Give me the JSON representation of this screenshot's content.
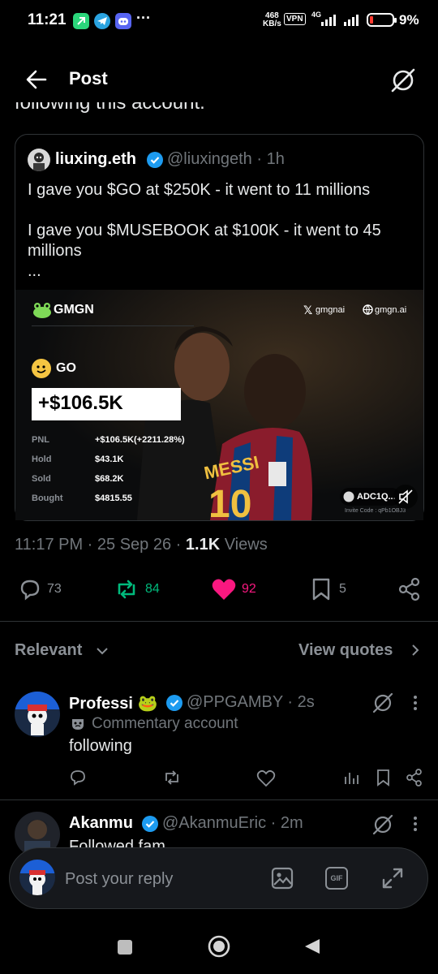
{
  "status_bar": {
    "time": "11:21",
    "more": "···",
    "net_speed_value": "468",
    "net_speed_unit": "KB/s",
    "vpn": "VPN",
    "network": "4G",
    "battery": "9%"
  },
  "header": {
    "title": "Post",
    "back_icon": "arrow-left-icon",
    "grok_icon": "grok-icon"
  },
  "truncated_text": "following this account.",
  "quote": {
    "author_name": "liuxing.eth",
    "author_handle": "@liuxingeth · 1h",
    "line1": "I gave you $GO at $250K - it went to 11 millions",
    "line2a": "I gave you $MUSEBOOK at $100K - it went to 45",
    "line2b": "millions",
    "ellipsis": "...",
    "media": {
      "brand": "GMGN",
      "x_handle": "gmgnai",
      "site": "gmgn.ai",
      "token": "GO",
      "headline_pnl": "+$106.5K",
      "rows": [
        {
          "label": "PNL",
          "value": "+$106.5K(+2211.28%)"
        },
        {
          "label": "Hold",
          "value": "$43.1K"
        },
        {
          "label": "Sold",
          "value": "$68.2K"
        },
        {
          "label": "Bought",
          "value": "$4815.55"
        }
      ],
      "invite_badge": "ADC1Q...",
      "invite_code": "Invite Code : qPb1OBJ3"
    }
  },
  "meta": {
    "time": "11:17 PM",
    "date": "25 Sep 26",
    "views_count": "1.1K",
    "views_label": "Views"
  },
  "actions": {
    "replies": "73",
    "reposts": "84",
    "likes": "92",
    "bookmarks": "5",
    "accent_repost": "#00ba7c",
    "accent_like": "#f91880"
  },
  "filter": {
    "relevant": "Relevant",
    "view_quotes": "View quotes"
  },
  "replies": [
    {
      "name": "Professi 🐸",
      "handle": "@PPGAMBY · 2s",
      "label": "Commentary account",
      "text": "following"
    },
    {
      "name": "Akanmu",
      "handle": "@AkanmuEric · 2m",
      "text": "Followed fam"
    }
  ],
  "reply_box": {
    "placeholder": "Post your reply",
    "gif": "GIF"
  },
  "colors": {
    "verified": "#1d9bf0",
    "background": "#000000",
    "divider": "#2f3336"
  }
}
